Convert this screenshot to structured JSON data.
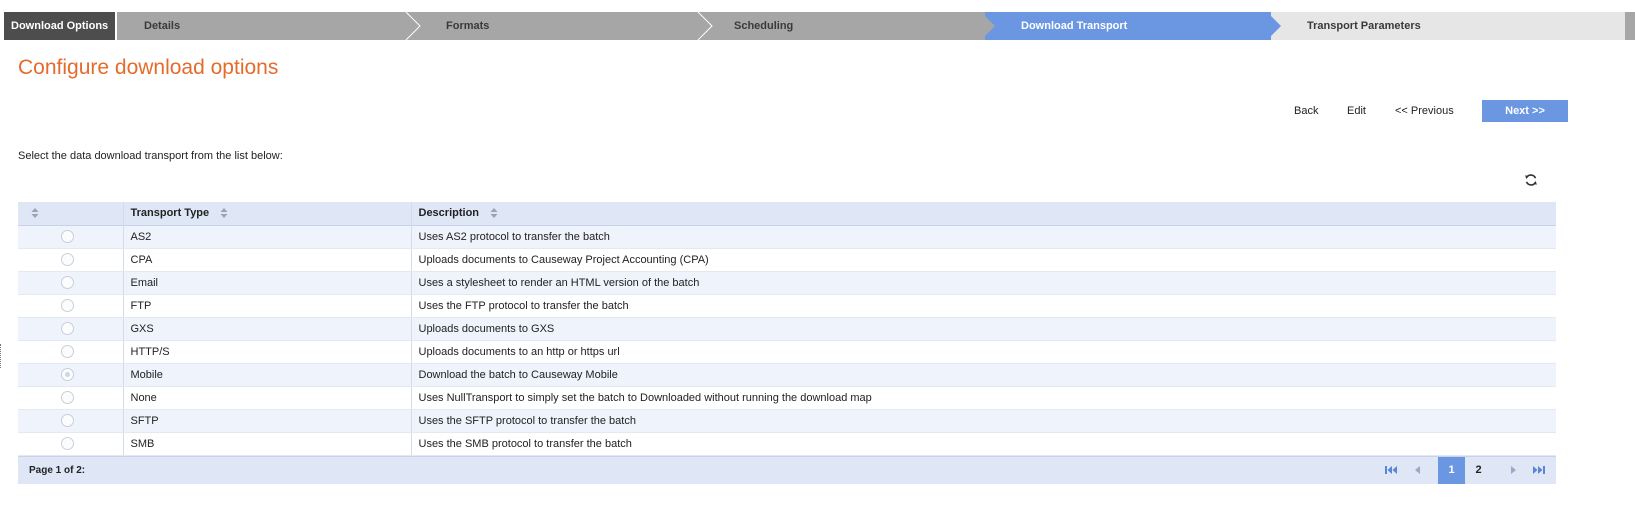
{
  "wizard": {
    "steps": [
      {
        "label": "Download Options"
      },
      {
        "label": "Details"
      },
      {
        "label": "Formats"
      },
      {
        "label": "Scheduling"
      },
      {
        "label": "Download Transport"
      },
      {
        "label": "Transport Parameters"
      }
    ],
    "active_step": "Download Transport"
  },
  "page": {
    "title": "Configure download options",
    "instruction": "Select the data download transport from the list below:"
  },
  "actions": {
    "back": "Back",
    "edit": "Edit",
    "previous": "<< Previous",
    "next": "Next >>"
  },
  "grid": {
    "columns": [
      "",
      "Transport Type",
      "Description"
    ],
    "rows": [
      {
        "type": "AS2",
        "description": "Uses AS2 protocol to transfer the batch"
      },
      {
        "type": "CPA",
        "description": "Uploads documents to Causeway Project Accounting (CPA)"
      },
      {
        "type": "Email",
        "description": "Uses a stylesheet to render an HTML version of the batch"
      },
      {
        "type": "FTP",
        "description": "Uses the FTP protocol to transfer the batch"
      },
      {
        "type": "GXS",
        "description": "Uploads documents to GXS"
      },
      {
        "type": "HTTP/S",
        "description": "Uploads documents to an http or https url"
      },
      {
        "type": "Mobile",
        "description": "Download the batch to Causeway Mobile"
      },
      {
        "type": "None",
        "description": "Uses NullTransport to simply set the batch to Downloaded without running the download map"
      },
      {
        "type": "SFTP",
        "description": "Uses the SFTP protocol to transfer the batch"
      },
      {
        "type": "SMB",
        "description": "Uses the SMB protocol to transfer the batch"
      }
    ],
    "pager": {
      "info": "Page 1 of 2:",
      "pages": [
        "1",
        "2"
      ],
      "current_page": "1"
    }
  },
  "icons": {
    "refresh": "refresh-icon",
    "sort": "sort-icon",
    "first": "first-page-icon",
    "prev": "prev-page-icon",
    "next": "next-page-icon",
    "last": "last-page-icon"
  },
  "colors": {
    "title_accent": "#e56b2b",
    "active_step": "#6a96e2",
    "inactive_step": "#a6a6a6",
    "upcoming_step": "#e6e6e6",
    "first_step": "#4d4d4d",
    "next_button": "#6a96e2",
    "grid_header": "#dfe7f7",
    "grid_row_alt": "#eef3fc"
  }
}
